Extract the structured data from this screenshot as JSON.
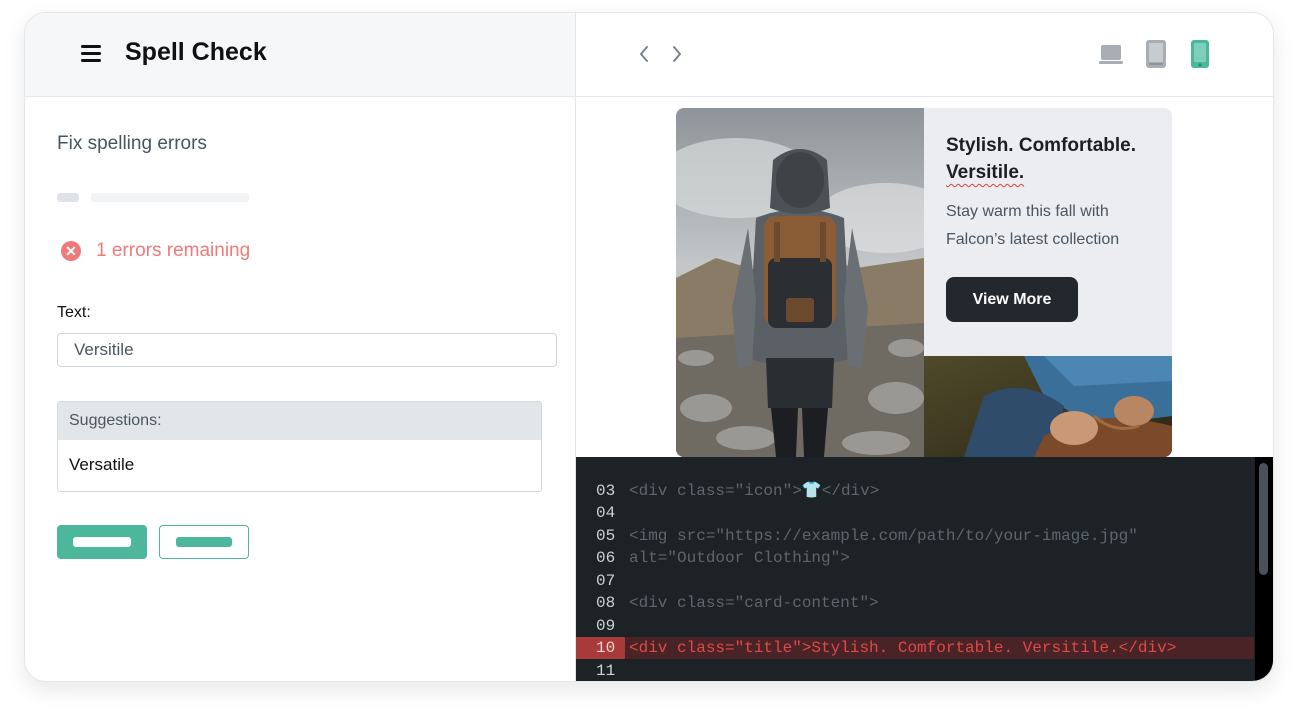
{
  "app": {
    "title": "Spell Check"
  },
  "panel": {
    "task_title": "Fix spelling errors",
    "error_status": "1 errors remaining",
    "text_label": "Text:",
    "text_value": "Versitile",
    "suggestions_label": "Suggestions:",
    "suggestions": [
      "Versatile"
    ]
  },
  "toolbar": {
    "icons": [
      "chevron-left-icon",
      "chevron-right-icon",
      "laptop-icon",
      "tablet-icon",
      "mobile-icon"
    ],
    "active_device": "mobile"
  },
  "preview": {
    "title_before": "Stylish. Comfortable.",
    "title_error_word": "Versitile.",
    "subtitle": "Stay warm this fall with Falcon’s latest collection",
    "button_label": "View More"
  },
  "code": {
    "lines": [
      {
        "num": "03",
        "text": "<div class=\"icon\">👕</div>",
        "highlight": false
      },
      {
        "num": "04",
        "text": "",
        "highlight": false
      },
      {
        "num": "05",
        "text": "<img src=\"https://example.com/path/to/your-image.jpg\"",
        "highlight": false
      },
      {
        "num": "06",
        "text": "alt=\"Outdoor Clothing\">",
        "highlight": false
      },
      {
        "num": "07",
        "text": "",
        "highlight": false
      },
      {
        "num": "08",
        "text": "<div class=\"card-content\">",
        "highlight": false
      },
      {
        "num": "09",
        "text": "",
        "highlight": false
      },
      {
        "num": "10",
        "text": "<div class=\"title\">Stylish. Comfortable. Versitile.</div>",
        "highlight": true
      },
      {
        "num": "11",
        "text": "",
        "highlight": false
      }
    ]
  },
  "colors": {
    "accent": "#4db79b",
    "error": "#ef7a7a",
    "code_bg": "#1d2226",
    "highlight_line": "#a83a3a",
    "button_dark": "#22282e"
  }
}
